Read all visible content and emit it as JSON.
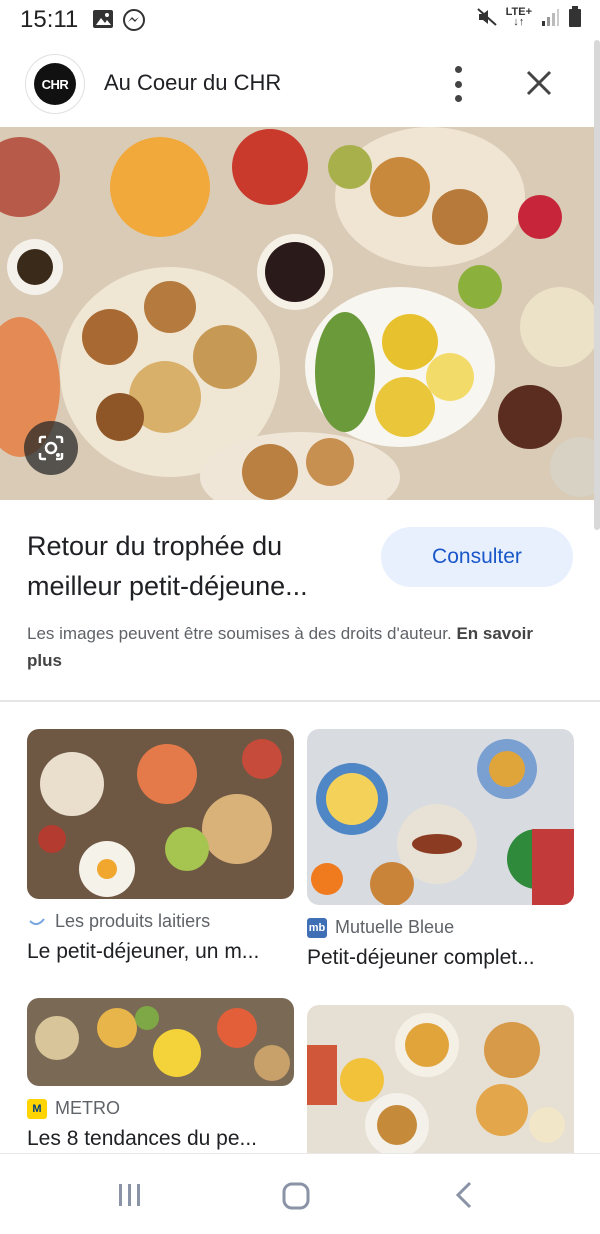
{
  "status_bar": {
    "time": "15:11",
    "network": "LTE+"
  },
  "header": {
    "logo_text": "CHR",
    "site_name": "Au Coeur du CHR"
  },
  "main": {
    "title": "Retour du trophée du meilleur petit-déjeune...",
    "consult_label": "Consulter",
    "copyright_text": "Les images peuvent être soumises à des droits d'auteur.",
    "learn_more_label": "En savoir plus"
  },
  "related": [
    {
      "source": "Les produits laitiers",
      "title": "Le petit-déjeuner, un m...",
      "icon": "dairy-swoosh-icon"
    },
    {
      "source": "Mutuelle Bleue",
      "title": "Petit-déjeuner complet...",
      "icon": "mb-logo-icon"
    },
    {
      "source": "METRO",
      "title": "Les 8 tendances du pe...",
      "icon": "metro-logo-icon"
    }
  ],
  "colors": {
    "accent": "#1a57c8",
    "button_bg": "#e8f0fe",
    "metro_yellow": "#ffd400",
    "metro_blue": "#003d7c",
    "mb_blue": "#3f6fb5"
  }
}
